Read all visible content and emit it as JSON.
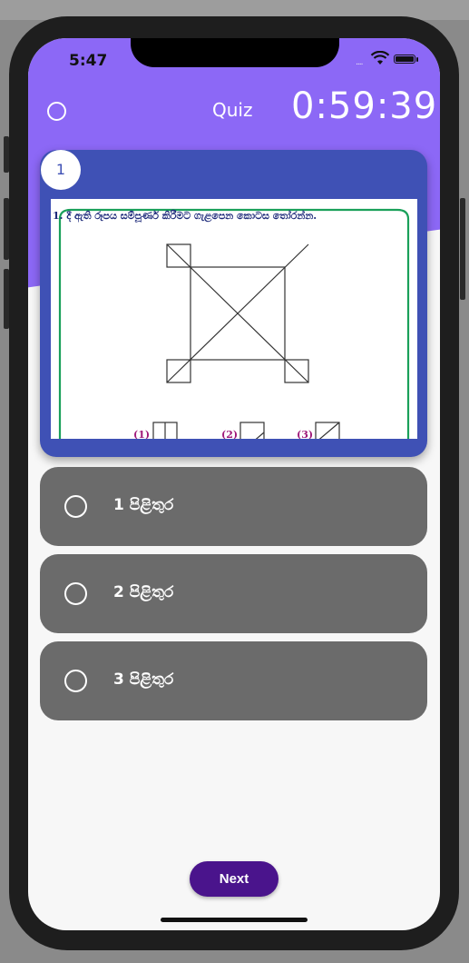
{
  "status_bar": {
    "time": "5:47",
    "signal": "....",
    "wifi_icon": "wifi-icon",
    "battery_icon": "battery-icon"
  },
  "header": {
    "title": "Quiz",
    "timer": "0:59:39",
    "left_icon": "circle-outline-icon"
  },
  "question": {
    "number": "1",
    "text": "1. දී ඇති රූපය සම්පූර්ණ කිරීමට ගැළපෙන කොටස තෝරන්න.",
    "option_labels": [
      "(1)",
      "(2)",
      "(3)"
    ]
  },
  "answers": [
    {
      "number": "1",
      "label": "පිළිතුර"
    },
    {
      "number": "2",
      "label": "පිළිතුර"
    },
    {
      "number": "3",
      "label": "පිළිතුර"
    }
  ],
  "footer": {
    "next_label": "Next"
  },
  "colors": {
    "header": "#8c68f6",
    "card": "#3f51b5",
    "answer_bg": "#6b6b6b",
    "next_button": "#4a148c"
  }
}
